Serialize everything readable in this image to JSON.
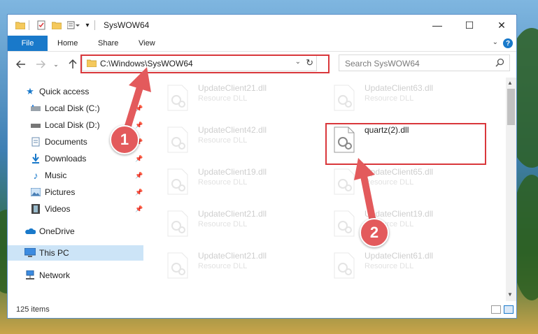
{
  "window": {
    "title": "SysWOW64",
    "controls": {
      "minimize": "—",
      "maximize": "☐",
      "close": "✕"
    }
  },
  "ribbon": {
    "tabs": [
      "File",
      "Home",
      "Share",
      "View"
    ],
    "help": "?"
  },
  "address": {
    "path": "C:\\Windows\\SysWOW64"
  },
  "search": {
    "placeholder": "Search SysWOW64"
  },
  "sidebar": {
    "items": [
      {
        "label": "Quick access",
        "icon": "star-icon"
      },
      {
        "label": "Local Disk (C:)",
        "icon": "drive-icon"
      },
      {
        "label": "Local Disk (D:)",
        "icon": "drive-icon"
      },
      {
        "label": "Documents",
        "icon": "documents-icon"
      },
      {
        "label": "Downloads",
        "icon": "downloads-icon"
      },
      {
        "label": "Music",
        "icon": "music-icon"
      },
      {
        "label": "Pictures",
        "icon": "pictures-icon"
      },
      {
        "label": "Videos",
        "icon": "videos-icon"
      },
      {
        "label": "OneDrive",
        "icon": "cloud-icon"
      },
      {
        "label": "This PC",
        "icon": "computer-icon"
      },
      {
        "label": "Network",
        "icon": "network-icon"
      }
    ],
    "selected": "This PC"
  },
  "files": [
    {
      "name": "UpdateClient21.dll",
      "type": "Resource DLL"
    },
    {
      "name": "UpdateClient63.dll",
      "type": "Resource DLL"
    },
    {
      "name": "UpdateClient42.dll",
      "type": "Resource DLL"
    },
    {
      "name": "quartz(2).dll",
      "type": ""
    },
    {
      "name": "UpdateClient19.dll",
      "type": "Resource DLL"
    },
    {
      "name": "UpdateClient65.dll",
      "type": "Resource DLL"
    },
    {
      "name": "UpdateClient21.dll",
      "type": "Resource DLL"
    },
    {
      "name": "UpdateClient19.dll",
      "type": "Resource DLL"
    },
    {
      "name": "UpdateClient21.dll",
      "type": "Resource DLL"
    },
    {
      "name": "UpdateClient61.dll",
      "type": "Resource DLL"
    }
  ],
  "status": {
    "count": "125 items"
  },
  "annotations": {
    "step1": "1",
    "step2": "2",
    "color": "#d9373b"
  }
}
